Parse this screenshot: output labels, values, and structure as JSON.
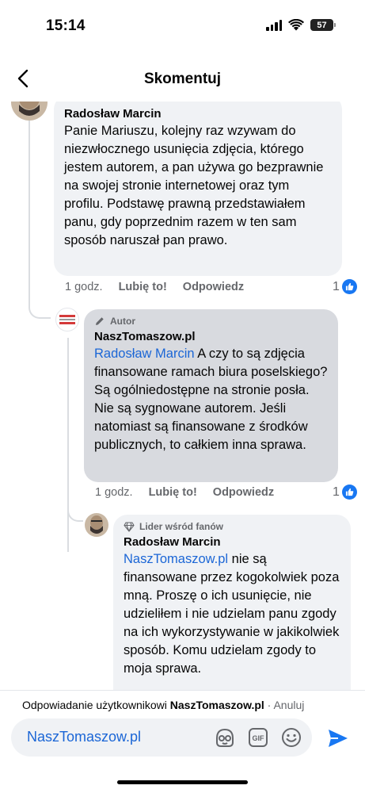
{
  "status_bar": {
    "time": "15:14",
    "battery": "57"
  },
  "header": {
    "title": "Skomentuj"
  },
  "comments": [
    {
      "name": "Radosław Marcin",
      "text": "Panie Mariuszu, kolejny raz wzywam do niezwłocznego usunięcia zdjęcia, którego jestem autorem, a pan używa go bezprawnie na swojej stronie internetowej oraz tym profilu. Podstawę prawną przedstawiałem panu, gdy poprzednim razem w ten sam sposób naruszał pan prawo.",
      "time": "1 godz.",
      "like_label": "Lubię to!",
      "reply_label": "Odpowiedz",
      "reaction_count": "1"
    },
    {
      "badge": "Autor",
      "name": "NaszTomaszow.pl",
      "mention": "Radosław Marcin",
      "text": " A czy to są zdjęcia finansowane  ramach biura poselskiego? Są ogólniedostępne na stronie posła. Nie są sygnowane autorem. Jeśli natomiast są finansowane z środków publicznych, to całkiem inna sprawa.",
      "time": "1 godz.",
      "like_label": "Lubię to!",
      "reply_label": "Odpowiedz",
      "reaction_count": "1"
    },
    {
      "badge": "Lider wśród fanów",
      "name": "Radosław Marcin",
      "mention": "NaszTomaszow.pl",
      "text": " nie są finansowane przez kogokolwiek poza mną. Proszę o ich usunięcie, nie udzieliłem i nie udzielam panu zgody na ich wykorzystywanie w jakikolwiek sposób. Komu udzielam zgody to moja sprawa."
    }
  ],
  "reply_bar": {
    "prefix": "Odpowiadanie użytkownikowi ",
    "target": "NaszTomaszow.pl",
    "separator": " · ",
    "cancel": "Anuluj"
  },
  "composer": {
    "value": "NaszTomaszow.pl"
  },
  "colors": {
    "like": "#1877f2",
    "mention": "#1b66d6",
    "send": "#1877f2",
    "bubble": "#f0f2f5",
    "author_bubble": "#d8dadf"
  },
  "icons": [
    "back-arrow-icon",
    "pencil-icon",
    "diamond-icon",
    "like-icon",
    "avatar-sticker-icon",
    "gif-icon",
    "emoji-icon",
    "send-icon"
  ]
}
